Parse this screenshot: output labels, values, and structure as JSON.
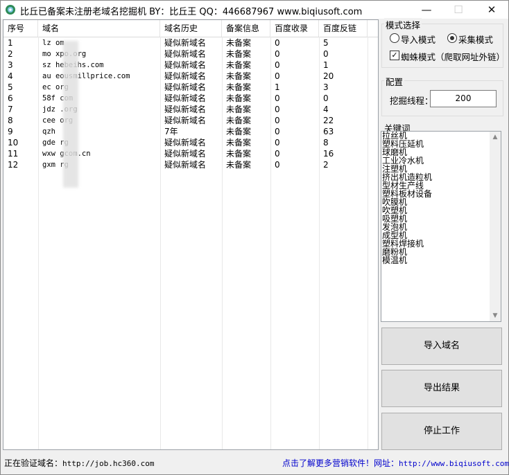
{
  "window": {
    "title": "比丘已备案未注册老域名挖掘机 BY：比丘王 QQ：446687967 www.biqiusoft.com",
    "minimize": "—",
    "maximize": "☐",
    "close": "✕"
  },
  "table": {
    "headers": [
      "序号",
      "域名",
      "域名历史",
      "备案信息",
      "百度收录",
      "百度反链"
    ],
    "rows": [
      [
        "1",
        "lz      om",
        "疑似新域名",
        "未备案",
        "0",
        "5"
      ],
      [
        "2",
        "mo      xpo.org",
        "疑似新域名",
        "未备案",
        "0",
        "0"
      ],
      [
        "3",
        "sz      hebeihs.com",
        "疑似新域名",
        "未备案",
        "0",
        "1"
      ],
      [
        "4",
        "au      eousmillprice.com",
        "疑似新域名",
        "未备案",
        "0",
        "20"
      ],
      [
        "5",
        "ec      org",
        "疑似新域名",
        "未备案",
        "1",
        "3"
      ],
      [
        "6",
        "58f      com",
        "疑似新域名",
        "未备案",
        "0",
        "0"
      ],
      [
        "7",
        "jdz      .org",
        "疑似新域名",
        "未备案",
        "0",
        "4"
      ],
      [
        "8",
        "cee      org",
        "疑似新域名",
        "未备案",
        "0",
        "22"
      ],
      [
        "9",
        "qzh",
        "7年",
        "未备案",
        "0",
        "63"
      ],
      [
        "10",
        "gde      rg",
        "疑似新域名",
        "未备案",
        "0",
        "8"
      ],
      [
        "11",
        "wxw      gcom.cn",
        "疑似新域名",
        "未备案",
        "0",
        "16"
      ],
      [
        "12",
        "gxm      rg",
        "疑似新域名",
        "未备案",
        "0",
        "2"
      ]
    ]
  },
  "mode": {
    "title": "模式选择",
    "import_label": "导入模式",
    "collect_label": "采集模式",
    "selected": "采集模式",
    "spider_label": "蜘蛛模式（爬取网址外链）",
    "spider_checked": true,
    "check_mark": "✓"
  },
  "config": {
    "title": "配置",
    "threads_label": "挖掘线程：",
    "threads_value": "200"
  },
  "keywords": {
    "title": "关键词",
    "items": [
      "拉丝机",
      "塑料压延机",
      "球磨机",
      "工业冷水机",
      "注塑机",
      "挤出机造粒机",
      "型材生产线",
      "塑料板材设备",
      "吹膜机",
      "吹塑机",
      "吸塑机",
      "发泡机",
      "成型机",
      "塑料焊接机",
      "磨粉机",
      "模温机"
    ],
    "scroll_up": "▲",
    "scroll_down": "▼"
  },
  "buttons": {
    "import": "导入域名",
    "export": "导出结果",
    "stop": "停止工作"
  },
  "status": {
    "verifying_label": "正在验证域名：",
    "verifying_url": "http://job.hc360.com",
    "promo_text": "点击了解更多营销软件！网址：",
    "promo_url": "http://www.biqiusoft.com"
  },
  "colors": {
    "link": "#0000cc",
    "window_bg": "#f0f0f0",
    "button_bg": "#e1e1e1"
  }
}
